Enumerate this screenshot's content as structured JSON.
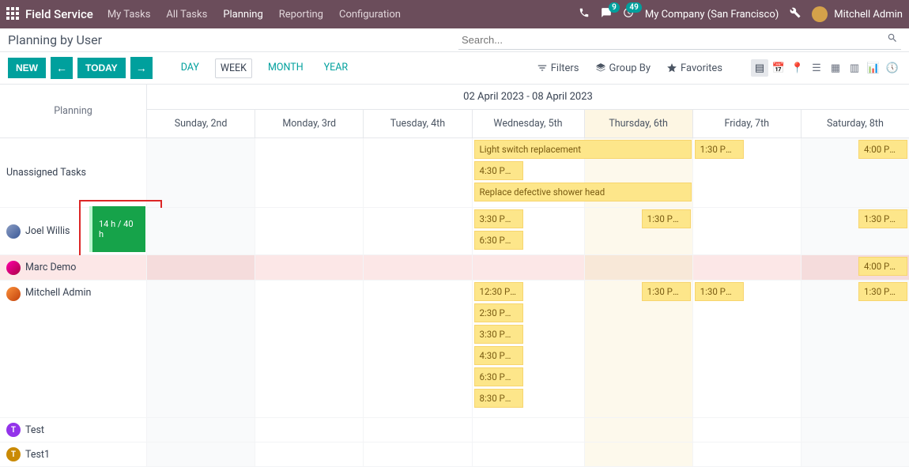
{
  "topbar": {
    "brand": "Field Service",
    "nav": [
      "My Tasks",
      "All Tasks",
      "Planning",
      "Reporting",
      "Configuration"
    ],
    "nav_active": 2,
    "msg_badge": "9",
    "activity_badge": "49",
    "company": "My Company (San Francisco)",
    "username": "Mitchell Admin"
  },
  "page": {
    "title": "Planning by User",
    "search_placeholder": "Search..."
  },
  "toolbar": {
    "new_label": "NEW",
    "today_label": "TODAY",
    "ranges": [
      "DAY",
      "WEEK",
      "MONTH",
      "YEAR"
    ],
    "range_active": 1,
    "filters_label": "Filters",
    "groupby_label": "Group By",
    "favorites_label": "Favorites"
  },
  "gantt": {
    "planning_label": "Planning",
    "date_range": "02 April 2023 - 08 April 2023",
    "days": [
      "Sunday, 2nd",
      "Monday, 3rd",
      "Tuesday, 4th",
      "Wednesday, 5th",
      "Thursday, 6th",
      "Friday, 7th",
      "Saturday, 8th"
    ],
    "today_index": 4,
    "rows": {
      "unassigned": {
        "label": "Unassigned Tasks"
      },
      "joel": {
        "label": "Joel Willis",
        "capacity": "14 h / 40 h"
      },
      "marc": {
        "label": "Marc Demo"
      },
      "mitchell": {
        "label": "Mitchell Admin"
      },
      "test": {
        "label": "Test",
        "initial": "T"
      },
      "test1": {
        "label": "Test1",
        "initial": "T"
      }
    },
    "tasks": {
      "unassigned_wed": [
        {
          "label": "Light switch replacement",
          "span": 2
        },
        {
          "label": "4:30 PM - ..."
        },
        {
          "label": "Replace defective shower head",
          "span": 2
        }
      ],
      "unassigned_fri": [
        {
          "label": "1:30 PM - ..."
        }
      ],
      "unassigned_sat": [
        {
          "label": "4:00 PM - ..."
        }
      ],
      "joel_wed": [
        {
          "label": "3:30 PM - ..."
        },
        {
          "label": "6:30 PM - ..."
        }
      ],
      "joel_thu": [
        {
          "label": "1:30 PM - ..."
        }
      ],
      "joel_sat": [
        {
          "label": "1:30 PM - ..."
        }
      ],
      "marc_sat": [
        {
          "label": "4:00 PM - ..."
        }
      ],
      "mitchell_wed": [
        {
          "label": "12:30 PM ..."
        },
        {
          "label": "2:30 PM - ..."
        },
        {
          "label": "3:30 PM - ..."
        },
        {
          "label": "4:30 PM - ..."
        },
        {
          "label": "6:30 PM - ..."
        },
        {
          "label": "8:30 PM - ..."
        }
      ],
      "mitchell_thu": [
        {
          "label": "1:30 PM - ...",
          "mark": true
        }
      ],
      "mitchell_fri": [
        {
          "label": "1:30 PM - ..."
        }
      ],
      "mitchell_sat": [
        {
          "label": "1:30 PM - ..."
        }
      ]
    }
  }
}
